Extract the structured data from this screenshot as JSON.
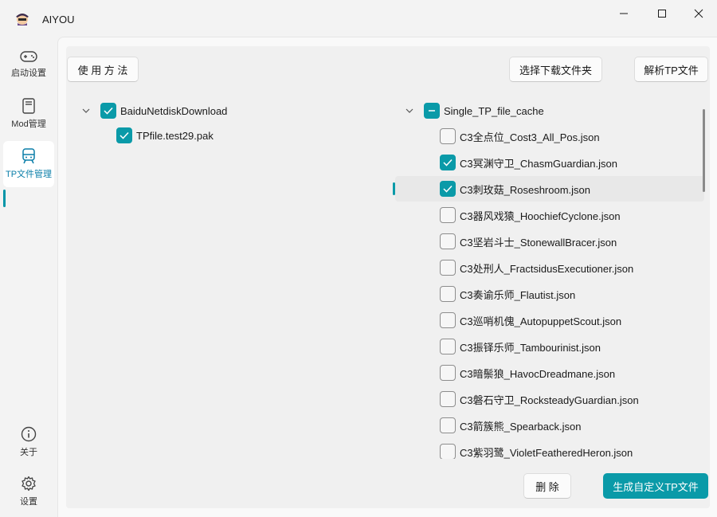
{
  "window": {
    "title": "AIYOU",
    "minimize_icon": "minimize-icon",
    "maximize_icon": "maximize-icon",
    "close_icon": "close-icon"
  },
  "nav": {
    "items": [
      {
        "label": "启动设置",
        "icon": "gamepad-icon"
      },
      {
        "label": "Mod管理",
        "icon": "book-icon"
      },
      {
        "label": "TP文件管理",
        "icon": "train-icon"
      },
      {
        "label": "关于",
        "icon": "info-icon"
      },
      {
        "label": "设置",
        "icon": "gear-icon"
      }
    ]
  },
  "toolbar": {
    "usage_label": "使 用 方 法",
    "select_folder_label": "选择下载文件夹",
    "parse_tp_label": "解析TP文件"
  },
  "left_tree": {
    "root": {
      "label": "BaiduNetdiskDownload",
      "checked": true
    },
    "children": [
      {
        "label": "TPfile.test29.pak",
        "checked": true
      }
    ]
  },
  "right_tree": {
    "root": {
      "label": "Single_TP_file_cache",
      "state": "partial"
    },
    "children": [
      {
        "label": "C3全点位_Cost3_All_Pos.json",
        "checked": false
      },
      {
        "label": "C3冥渊守卫_ChasmGuardian.json",
        "checked": true
      },
      {
        "label": "C3刺玫菇_Roseshroom.json",
        "checked": true
      },
      {
        "label": "C3器风戏猿_HoochiefCyclone.json",
        "checked": false
      },
      {
        "label": "C3坚岩斗士_StonewallBracer.json",
        "checked": false
      },
      {
        "label": "C3处刑人_FractsidusExecutioner.json",
        "checked": false
      },
      {
        "label": "C3奏谕乐师_Flautist.json",
        "checked": false
      },
      {
        "label": "C3巡哨机傀_AutopuppetScout.json",
        "checked": false
      },
      {
        "label": "C3振铎乐师_Tambourinist.json",
        "checked": false
      },
      {
        "label": "C3暗鬃狼_HavocDreadmane.json",
        "checked": false
      },
      {
        "label": "C3磐石守卫_RocksteadyGuardian.json",
        "checked": false
      },
      {
        "label": "C3箭簇熊_Spearback.json",
        "checked": false
      },
      {
        "label": "C3紫羽鹭_VioletFeatheredHeron.json",
        "checked": false
      }
    ]
  },
  "footer": {
    "delete_label": "删  除",
    "generate_label": "生成自定义TP文件"
  },
  "colors": {
    "accent": "#0a9aa8",
    "nav_active_text": "#0a7ea8"
  }
}
